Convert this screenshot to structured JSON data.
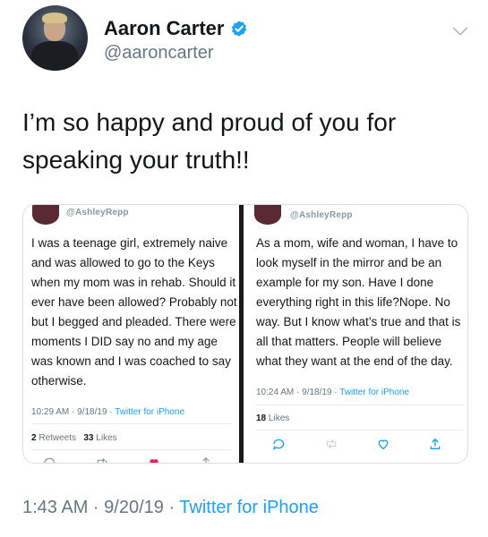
{
  "user": {
    "name": "Aaron Carter",
    "handle": "@aaroncarter"
  },
  "tweet": {
    "text": "I’m so happy and proud of you for speaking your truth!!"
  },
  "media": {
    "left": {
      "handle": "@AshleyRepp",
      "text": "I was a teenage girl, extremely naive and was allowed to go to the Keys when my mom was in rehab. Should it ever have been allowed? Probably not but I begged and pleaded. There were moments I DID say no and my age was known and I was coached to say otherwise.",
      "time": "10:29 AM · 9/18/19 · ",
      "source": "Twitter for iPhone",
      "retweets": "2",
      "retweets_label": "Retweets",
      "likes": "33",
      "likes_label": "Likes"
    },
    "right": {
      "handle": "@AshleyRepp",
      "text": "As a mom, wife and woman, I have to look myself in the mirror and be an example for my son. Have I done everything right in this life?Nope. No way. But I know what’s true and that is all that matters. People will believe what they want at the end of the day.",
      "time": "10:24 AM · 9/18/19 · ",
      "source": "Twitter for iPhone",
      "likes": "18",
      "likes_label": "Likes"
    }
  },
  "footer": {
    "time": "1:43 AM · 9/20/19 · ",
    "source": "Twitter for iPhone"
  },
  "colors": {
    "accent": "#1da1f2",
    "secondary_text": "#657786",
    "like_red": "#e0245e"
  },
  "icons": [
    "verified-badge-icon",
    "chevron-down-icon",
    "reply-icon",
    "retweet-icon",
    "like-icon",
    "share-icon"
  ]
}
